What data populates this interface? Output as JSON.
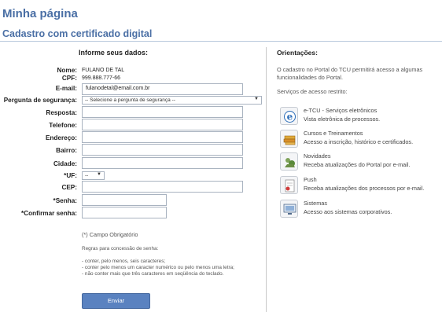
{
  "page": {
    "title": "Minha página",
    "section_title": "Cadastro com certificado digital"
  },
  "form": {
    "heading": "Informe seus dados:",
    "nome": {
      "label": "Nome:",
      "value": "FULANO DE TAL"
    },
    "cpf": {
      "label": "CPF:",
      "value": "999.888.777-66"
    },
    "email": {
      "label": "E-mail:",
      "value": "fulanodetal@email.com.br"
    },
    "pergunta": {
      "label": "Pergunta de segurança:",
      "value": "-- Selecione a pergunta de segurança --"
    },
    "resposta": {
      "label": "Resposta:"
    },
    "telefone": {
      "label": "Telefone:"
    },
    "endereco": {
      "label": "Endereço:"
    },
    "bairro": {
      "label": "Bairro:"
    },
    "cidade": {
      "label": "Cidade:"
    },
    "uf": {
      "label": "*UF:",
      "value": "--"
    },
    "cep": {
      "label": "CEP:"
    },
    "senha": {
      "label": "*Senha:"
    },
    "confirmar_senha": {
      "label": "*Confirmar senha:"
    },
    "required_note": "(*) Campo Obrigatório",
    "rules_title": "Regras para concessão de senha:",
    "rules": [
      "- conter, pelo menos, seis caracteres;",
      "- conter pelo menos um caracter numérico ou pelo menos uma letra;",
      "- não conter mais que três caracteres em seqüência do teclado."
    ],
    "submit_label": "Enviar"
  },
  "orientacoes": {
    "title": "Orientações:",
    "text": "O cadastro no Portal do TCU permitirá acesso a algumas funcionalidades do Portal.",
    "access_label": "Serviços de acesso restrito:",
    "services": [
      {
        "name": "e-TCU - Serviços eletrônicos",
        "desc": "Vista eletrônica de processos.",
        "icon": "e-tcu-icon"
      },
      {
        "name": "Cursos e Treinamentos",
        "desc": "Acesso a inscrição, histórico e certificados.",
        "icon": "courses-icon"
      },
      {
        "name": "Novidades",
        "desc": "Receba atualizações do Portal por e-mail.",
        "icon": "news-icon"
      },
      {
        "name": "Push",
        "desc": "Receba atualizações dos processos por e-mail.",
        "icon": "push-icon"
      },
      {
        "name": "Sistemas",
        "desc": "Acesso aos sistemas corporativos.",
        "icon": "systems-icon"
      }
    ]
  },
  "colors": {
    "title_blue": "#4a6fa5",
    "button_blue": "#5a82c0"
  }
}
